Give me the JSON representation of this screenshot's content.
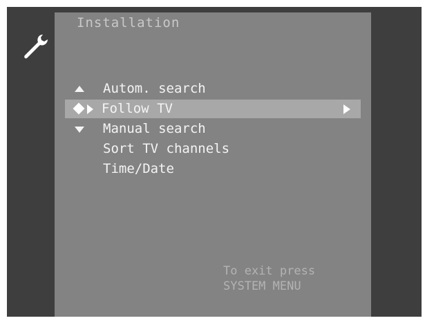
{
  "menu": {
    "title": "Installation",
    "icon": "wrench-icon",
    "items": [
      {
        "label": "Autom. search",
        "marker": "up-arrow-icon"
      },
      {
        "label": "Follow TV",
        "marker": "diamond-cursor-icon",
        "selected": true,
        "has_submenu": true
      },
      {
        "label": "Manual search",
        "marker": "down-arrow-icon"
      },
      {
        "label": "Sort TV channels"
      },
      {
        "label": "Time/Date"
      }
    ]
  },
  "footer": {
    "line1": "To exit press",
    "line2": "SYSTEM MENU"
  },
  "colors": {
    "screen_background": "#3e3e3e",
    "panel_background": "#838383",
    "highlight": "#a8a8a8",
    "text": "#f4f4f4",
    "title_text": "#c9c9c9",
    "hint_text": "#b3b3b3"
  }
}
